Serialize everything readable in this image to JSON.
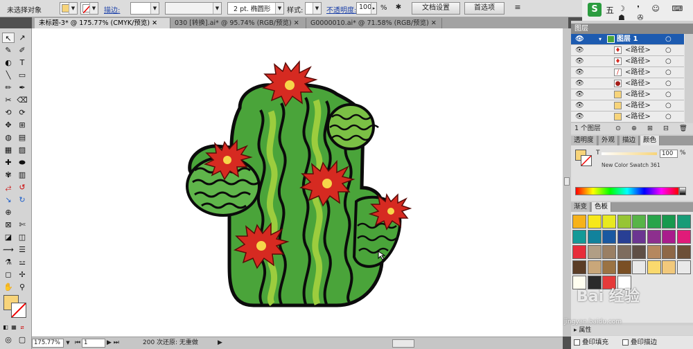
{
  "control": {
    "selection": "未选择对象",
    "stroke_label": "描边:",
    "brush_value": "2 pt. 椭圆形",
    "style_label": "样式:",
    "opacity_label": "不透明度:",
    "opacity_value": "100",
    "percent": "%",
    "doc_setup": "文档设置",
    "preferences": "首选项"
  },
  "tabs": [
    {
      "label": "未标题-3* @ 175.77% (CMYK/预览)"
    },
    {
      "label": "030 [转换].ai* @ 95.74% (RGB/预览)"
    },
    {
      "label": "G0000010.ai* @ 71.58% (RGB/预览)"
    }
  ],
  "tools": [
    "↖",
    "↗",
    "✎",
    "✐",
    "◐",
    "T",
    "╲",
    "▭",
    "✏",
    "✒",
    "✂",
    "⌫",
    "⟲",
    "⟳",
    "✥",
    "⊞",
    "▦",
    "▨",
    "✋",
    "⚲",
    "◪",
    "◫"
  ],
  "sys": {
    "ime": "五",
    "icons": [
      "moon-icon",
      "comma-icon",
      "smile-icon",
      "keyboard-icon",
      "shirt-icon",
      "wrench-icon"
    ]
  },
  "layers": {
    "title": "图层",
    "top_layer": "图层 1",
    "rows": [
      "<路径>",
      "<路径>",
      "<路径>",
      "<路径>",
      "<路径>",
      "<路径>",
      "<路径>"
    ],
    "count": "1 个图层"
  },
  "color_panel": {
    "tabs": [
      "透明度",
      "外观",
      "描边",
      "颜色"
    ],
    "t_label": "T",
    "swatch_name": "New Color Swatch 361",
    "value": "100",
    "percent": "%"
  },
  "swatch_panel": {
    "tabs": [
      "渐变",
      "色板"
    ],
    "colors": [
      "#f6b21a",
      "#f7e81b",
      "#e8e920",
      "#97c534",
      "#57b447",
      "#28a44a",
      "#17994e",
      "#179c77",
      "#139a97",
      "#11829c",
      "#1a58a1",
      "#283f94",
      "#6b3591",
      "#8d2f8e",
      "#a91c8c",
      "#e01b79",
      "#e72d3a",
      "#b19e85",
      "#9a7f64",
      "#7e6c5e",
      "#5f4f46",
      "#b5885f",
      "#8e6847",
      "#6d5037",
      "#5b3d26",
      "#c9a77a",
      "#9b7343",
      "#7a4f24",
      "#e9e9e9",
      "#fad96d",
      "#f2c97b",
      "#e9e9e9",
      "#fffef0",
      "#2b2b2b",
      "#e53a3a",
      "#ffffff"
    ]
  },
  "bottom": {
    "zoom": "175.77%",
    "page": "1",
    "undo": "200 次还原: 无重做",
    "fill_opt": "叠印填充",
    "stroke_opt": "叠印描边",
    "watermark": "Bai 经验",
    "watermark_url": "jingyan.baidu.com"
  }
}
